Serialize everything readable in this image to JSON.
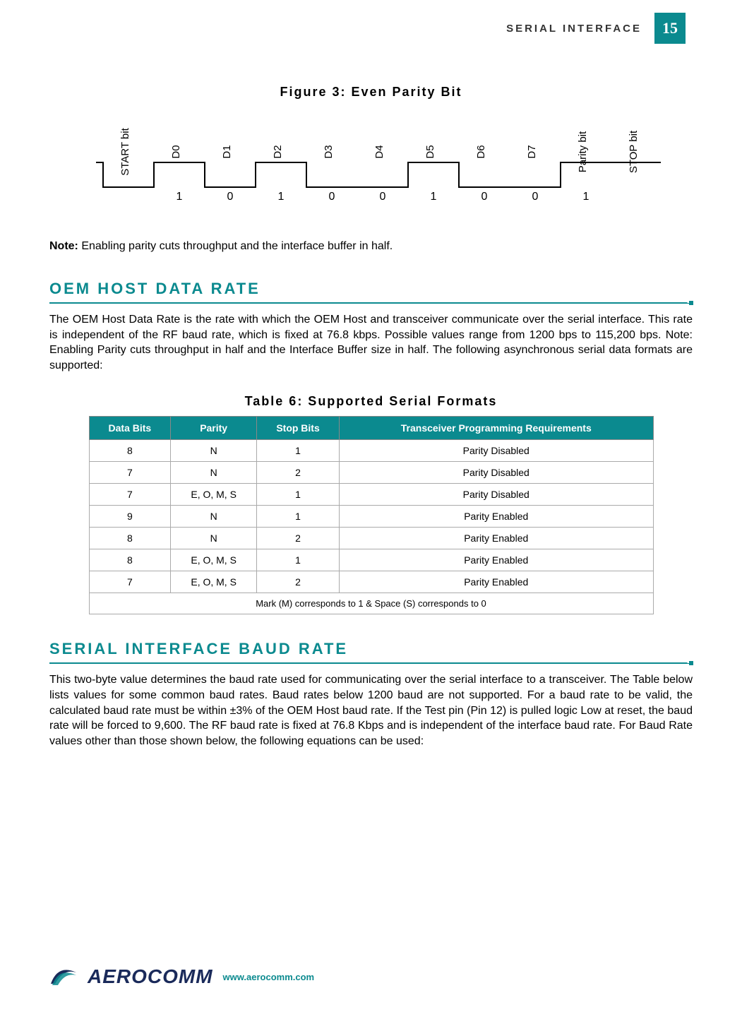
{
  "header": {
    "section": "SERIAL INTERFACE",
    "page": "15"
  },
  "figure3": {
    "title": "Figure 3: Even Parity Bit",
    "labels": [
      "START bit",
      "D0",
      "D1",
      "D2",
      "D3",
      "D4",
      "D5",
      "D6",
      "D7",
      "Parity bit",
      "STOP bit"
    ],
    "values": [
      "",
      "1",
      "0",
      "1",
      "0",
      "0",
      "1",
      "0",
      "0",
      "1",
      ""
    ]
  },
  "note": {
    "prefix": "Note:",
    "text": " Enabling parity cuts throughput and the interface buffer in half."
  },
  "oem": {
    "heading": "OEM HOST DATA RATE",
    "body": "The OEM Host Data Rate is the rate with which the OEM Host and transceiver communicate over the serial interface. This rate is independent of the RF baud rate, which is fixed at 76.8 kbps.  Possible values range from 1200 bps to 115,200 bps.  Note: Enabling Parity cuts throughput in half and the Interface Buffer size in half.  The following asynchronous serial data formats are supported:"
  },
  "table6": {
    "title": "Table 6: Supported Serial Formats",
    "headers": [
      "Data Bits",
      "Parity",
      "Stop Bits",
      "Transceiver Programming Requirements"
    ],
    "rows": [
      [
        "8",
        "N",
        "1",
        "Parity Disabled"
      ],
      [
        "7",
        "N",
        "2",
        "Parity Disabled"
      ],
      [
        "7",
        "E, O, M, S",
        "1",
        "Parity Disabled"
      ],
      [
        "9",
        "N",
        "1",
        "Parity Enabled"
      ],
      [
        "8",
        "N",
        "2",
        "Parity Enabled"
      ],
      [
        "8",
        "E, O, M, S",
        "1",
        "Parity Enabled"
      ],
      [
        "7",
        "E, O, M, S",
        "2",
        "Parity Enabled"
      ]
    ],
    "footnote": "Mark (M) corresponds to 1 & Space (S) corresponds to 0"
  },
  "baud": {
    "heading": "SERIAL INTERFACE BAUD RATE",
    "body": "This two-byte value determines the baud rate used for communicating over the serial interface to a transceiver.  The Table below lists values for some common baud rates.  Baud rates below 1200 baud are not supported. For a baud rate to be valid, the calculated baud rate must be within ±3% of the OEM Host baud rate.  If the Test pin (Pin 12) is pulled logic Low at reset, the baud rate will be forced to 9,600.  The RF baud rate is fixed at 76.8 Kbps and is independent of the interface baud rate.  For Baud Rate values other than those shown below, the following equations can be used:"
  },
  "footer": {
    "logo": "AEROCOMM",
    "url": "www.aerocomm.com"
  }
}
